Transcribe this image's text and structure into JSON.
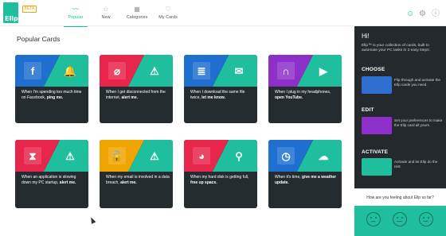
{
  "app": {
    "logo_text": "Ellp",
    "beta_badge": "BETA"
  },
  "nav": [
    {
      "label": "Popular",
      "icon": "trending-icon",
      "glyph": "〰",
      "active": true
    },
    {
      "label": "New",
      "icon": "star-icon",
      "glyph": "☆",
      "active": false
    },
    {
      "label": "Categories",
      "icon": "grid-icon",
      "glyph": "▦",
      "active": false
    },
    {
      "label": "My Cards",
      "icon": "heart-icon",
      "glyph": "♡",
      "active": false
    }
  ],
  "top_icons": [
    {
      "name": "smiley-icon",
      "glyph": "☺",
      "color": "#1fbf9e"
    },
    {
      "name": "gear-icon",
      "glyph": "⚙",
      "color": "#9a9a9a"
    },
    {
      "name": "info-icon",
      "glyph": "ⓘ",
      "color": "#9a9a9a"
    }
  ],
  "section_title": "Popular Cards",
  "cards": [
    {
      "left_color": "#1e6fcf",
      "left_glyph": "f",
      "left_icon": "facebook-icon",
      "right_color": "#1fbf9e",
      "right_glyph": "🔔",
      "right_icon": "bell-icon",
      "text_plain": "When I'm spending too much time on Facebook, ",
      "text_bold": "ping me.",
      "tab_color": "#f0a400"
    },
    {
      "left_color": "#e8254a",
      "left_glyph": "⌀",
      "left_icon": "wifi-off-icon",
      "right_color": "#1fbf9e",
      "right_glyph": "⚠",
      "right_icon": "warning-icon",
      "text_plain": "When I get disconnected from the internet, ",
      "text_bold": "alert me.",
      "tab_color": "#f0a400"
    },
    {
      "left_color": "#1e6fcf",
      "left_glyph": "≣",
      "left_icon": "files-icon",
      "right_color": "#1fbf9e",
      "right_glyph": "✉",
      "right_icon": "message-icon",
      "text_plain": "When I download the same file twice, ",
      "text_bold": "let me know.",
      "tab_color": "#cfd3d6"
    },
    {
      "left_color": "#8e2fc9",
      "left_glyph": "∩",
      "left_icon": "headphones-icon",
      "right_color": "#1fbf9e",
      "right_glyph": "▶",
      "right_icon": "youtube-icon",
      "text_plain": "When I plug in my headphones, ",
      "text_bold": "open YouTube.",
      "tab_color": "#cfd3d6"
    },
    {
      "left_color": "#e8254a",
      "left_glyph": "⧗",
      "left_icon": "hourglass-icon",
      "right_color": "#1fbf9e",
      "right_glyph": "⚠",
      "right_icon": "warning-icon",
      "text_plain": "When an application is slowing down my PC startup, ",
      "text_bold": "alert me.",
      "tab_color": "#cfd3d6"
    },
    {
      "left_color": "#f0a400",
      "left_glyph": "🔓",
      "left_icon": "unlock-icon",
      "right_color": "#1fbf9e",
      "right_glyph": "⚠",
      "right_icon": "warning-icon",
      "text_plain": "When my email is involved in a data breach, ",
      "text_bold": "alert me.",
      "tab_color": "#cfd3d6"
    },
    {
      "left_color": "#e8254a",
      "left_glyph": "◕",
      "left_icon": "pie-chart-icon",
      "right_color": "#1fbf9e",
      "right_glyph": "⚲",
      "right_icon": "broom-icon",
      "text_plain": "When my hard disk is getting full, ",
      "text_bold": "free up space.",
      "tab_color": "#cfd3d6"
    },
    {
      "left_color": "#1e6fcf",
      "left_glyph": "◷",
      "left_icon": "clock-icon",
      "right_color": "#1fbf9e",
      "right_glyph": "☁",
      "right_icon": "weather-icon",
      "text_plain": "When it's time, ",
      "text_bold": "give me a weather update.",
      "tab_color": "#cfd3d6"
    }
  ],
  "panel": {
    "greeting": "Hi!",
    "intro": "Ellp™ is your collection of cards, built to automate your PC tasks in 3 easy steps:",
    "steps": [
      {
        "title": "CHOOSE",
        "text": "Flip through and activate the Ellp cards you need.",
        "img_color": "#2e6fd0"
      },
      {
        "title": "EDIT",
        "text": "Set your preferences to make the Ellp card all yours.",
        "img_color": "#8e2fc9"
      },
      {
        "title": "ACTIVATE",
        "text": "Activate and let Ellp do the rest",
        "img_color": "#1fbf9e"
      }
    ]
  },
  "feedback": {
    "question": "How are you feeling about Ellp so far?",
    "faces": [
      {
        "name": "sad-face-icon",
        "mood": "sad"
      },
      {
        "name": "neutral-face-icon",
        "mood": "neutral"
      },
      {
        "name": "happy-face-icon",
        "mood": "happy"
      }
    ]
  }
}
